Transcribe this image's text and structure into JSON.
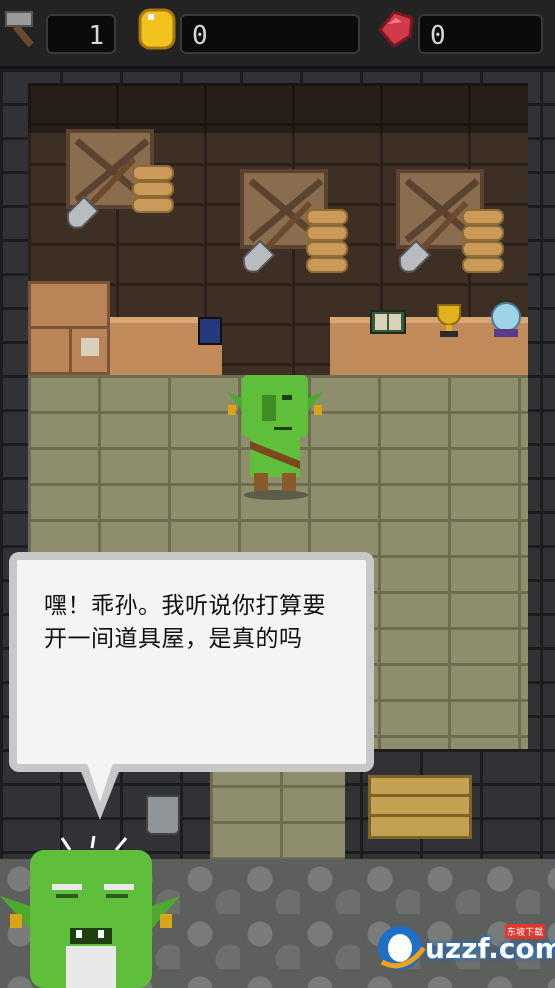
{
  "resources": {
    "hammer_count": "1",
    "coin_count": "0",
    "gem_count": "0"
  },
  "dialog": {
    "text": "嘿！乖孙。我听说你打算要开一间道具屋，是真的吗"
  },
  "watermark": {
    "brand": "uzzf.com",
    "tag": "东坡下载"
  },
  "colors": {
    "goblin_green": "#5fbf3a",
    "wood": "#c08a5a",
    "bubble_bg": "#f4f4f4"
  }
}
